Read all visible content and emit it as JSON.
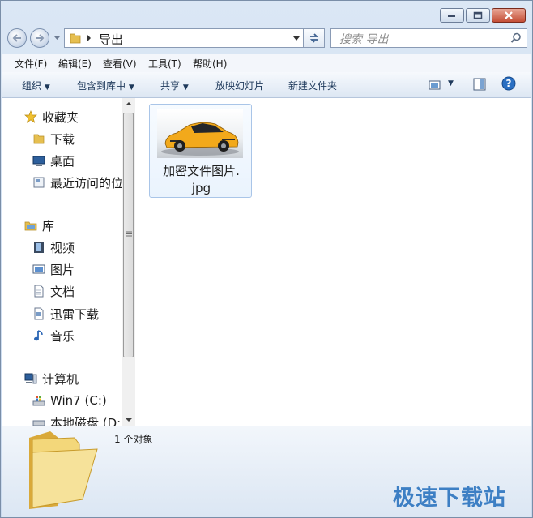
{
  "window": {
    "controls": {
      "minimize": "minimize-icon",
      "maximize": "maximize-icon",
      "close": "close-icon"
    }
  },
  "address": {
    "path": "导出",
    "search_placeholder": "搜索 导出"
  },
  "menu": [
    "文件(F)",
    "编辑(E)",
    "查看(V)",
    "工具(T)",
    "帮助(H)"
  ],
  "toolbar": {
    "organize": "组织",
    "include": "包含到库中",
    "share": "共享",
    "slideshow": "放映幻灯片",
    "new_folder": "新建文件夹"
  },
  "nav": {
    "favorites": "收藏夹",
    "downloads": "下载",
    "desktop": "桌面",
    "recent": "最近访问的位",
    "libraries": "库",
    "videos": "视频",
    "pictures": "图片",
    "documents": "文档",
    "xunlei": "迅雷下载",
    "music": "音乐",
    "computer": "计算机",
    "drive_c": "Win7 (C:)",
    "drive_d": "本地磁盘 (D:"
  },
  "files": [
    {
      "name_line1": "加密文件图片.",
      "name_line2": "jpg"
    }
  ],
  "status": {
    "count": "1 个对象"
  },
  "watermark": "极速下载站",
  "colors": {
    "accent": "#3d7fc4",
    "folder": "#e8c457",
    "car": "#f2a91b"
  }
}
